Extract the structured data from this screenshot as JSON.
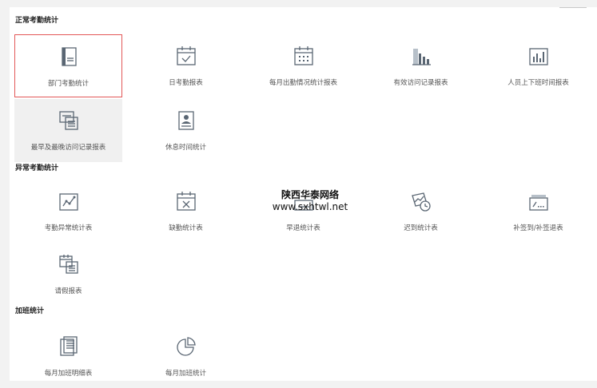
{
  "sections": {
    "normal": {
      "title": "正常考勤统计"
    },
    "abnormal": {
      "title": "异常考勤统计"
    },
    "overtime": {
      "title": "加班统计"
    }
  },
  "tiles": {
    "dept_stats": {
      "label": "部门考勤统计",
      "icon": "document-icon"
    },
    "daily_report": {
      "label": "日考勤报表",
      "icon": "calendar-check-icon"
    },
    "monthly_attendance": {
      "label": "每月出勤情况统计报表",
      "icon": "calendar-grid-icon"
    },
    "visit_records": {
      "label": "有效访问记录报表",
      "icon": "bar-chart-icon"
    },
    "on_off_duty": {
      "label": "人员上下班时间报表",
      "icon": "column-chart-icon"
    },
    "earliest_latest": {
      "label": "最早及最晚访问记录报表",
      "icon": "stacked-documents-icon"
    },
    "rest_time": {
      "label": "休息时间统计",
      "icon": "person-document-icon"
    },
    "abnormal_stats": {
      "label": "考勤异常统计表",
      "icon": "trend-chart-icon"
    },
    "absence_stats": {
      "label": "缺勤统计表",
      "icon": "calendar-x-icon"
    },
    "early_leave": {
      "label": "早退统计表",
      "icon": "calendar-hidden-icon"
    },
    "late_stats": {
      "label": "迟到统计表",
      "icon": "clock-chart-icon"
    },
    "makeup_sign": {
      "label": "补签到/补签退表",
      "icon": "signature-card-icon"
    },
    "leave_report": {
      "label": "请假报表",
      "icon": "leave-form-icon"
    },
    "overtime_detail": {
      "label": "每月加班明细表",
      "icon": "list-document-icon"
    },
    "overtime_stats": {
      "label": "每月加班统计",
      "icon": "pie-chart-icon"
    }
  },
  "watermark": {
    "line1": "陕西华泰网络",
    "line2": "www.sxhtwl.net"
  },
  "colors": {
    "selected_border": "#e35757",
    "icon": "#5a6673",
    "hover_bg": "#f0f0f0"
  }
}
